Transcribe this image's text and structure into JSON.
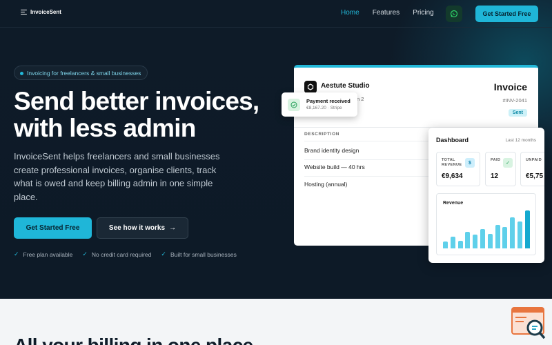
{
  "nav": {
    "brand": "InvoiceSent",
    "links": [
      "Home",
      "Features",
      "Pricing"
    ],
    "active": "Home",
    "cta": "Get Started Free"
  },
  "hero": {
    "pill": "Invoicing for freelancers & small businesses",
    "title_line1": "Send better invoices,",
    "title_line2": "with less admin",
    "subtitle": "InvoiceSent helps freelancers and small businesses create professional invoices, organise clients, track what is owed and keep billing admin in one simple place.",
    "primary_cta": "Get Started Free",
    "secondary_cta": "See how it works",
    "checks": [
      "Free plan available",
      "No credit card required",
      "Built for small businesses"
    ]
  },
  "invoice": {
    "studio": "Aestute Studio",
    "tag": "n 2",
    "title": "Invoice",
    "number": "#INV-2041",
    "status": "Sent",
    "description_header": "DESCRIPTION",
    "rows": [
      "Brand identity design",
      "Website build — 40 hrs",
      "Hosting (annual)"
    ]
  },
  "toast": {
    "title": "Payment received",
    "subtitle": "€8,167.20 · Stripe"
  },
  "dashboard": {
    "title": "Dashboard",
    "period": "Last 12 months",
    "stats": [
      {
        "label_line1": "TOTAL",
        "label_line2": "REVENUE",
        "value": "€9,634",
        "icon": "$"
      },
      {
        "label_line1": "PAID",
        "label_line2": "",
        "value": "12",
        "icon": "✓"
      },
      {
        "label_line1": "UNPAID",
        "label_line2": "",
        "value": "€5,75",
        "icon": ""
      }
    ],
    "revenue_title": "Revenue",
    "revenue_bars": [
      0.18,
      0.3,
      0.2,
      0.42,
      0.36,
      0.5,
      0.38,
      0.6,
      0.56,
      0.8,
      0.7,
      0.98
    ]
  },
  "lower": {
    "heading": "All your billing in one place"
  },
  "colors": {
    "accent": "#1fb6d8",
    "bg_dark": "#0e1b28"
  }
}
